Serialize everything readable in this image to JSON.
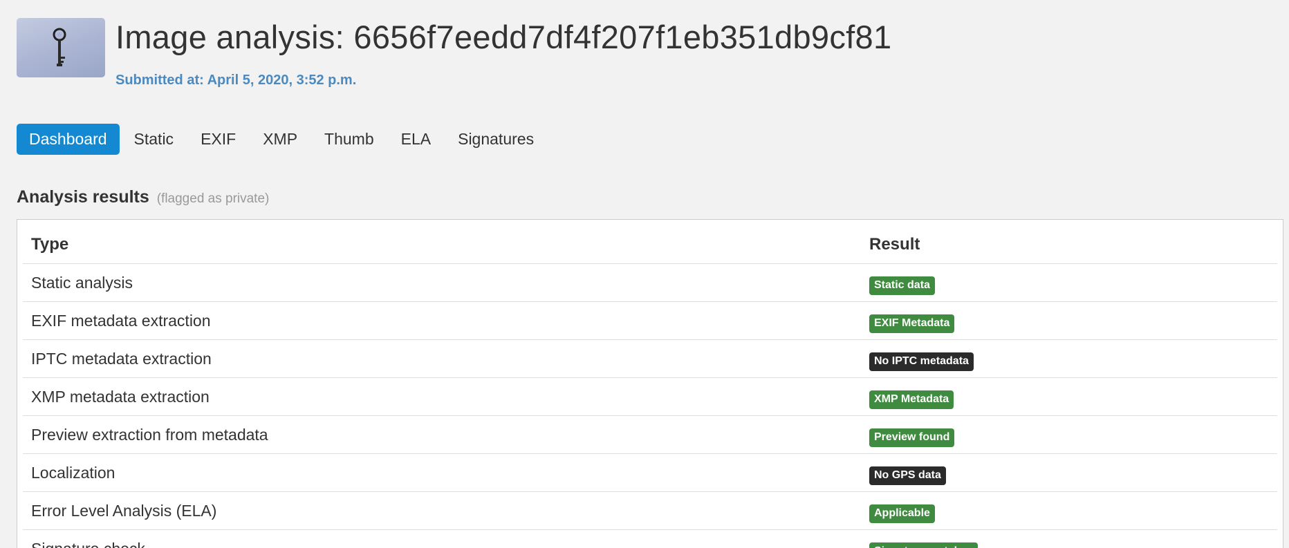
{
  "header": {
    "title": "Image analysis: 6656f7eedd7df4f207f1eb351db9cf81",
    "submitted_label": "Submitted at:",
    "submitted_value": "April 5, 2020, 3:52 p.m.",
    "thumbnail_icon": "key-thumbnail"
  },
  "nav": {
    "tabs": [
      {
        "label": "Dashboard",
        "active": true
      },
      {
        "label": "Static",
        "active": false
      },
      {
        "label": "EXIF",
        "active": false
      },
      {
        "label": "XMP",
        "active": false
      },
      {
        "label": "Thumb",
        "active": false
      },
      {
        "label": "ELA",
        "active": false
      },
      {
        "label": "Signatures",
        "active": false
      }
    ]
  },
  "results": {
    "title": "Analysis results",
    "note": "(flagged as private)",
    "columns": [
      "Type",
      "Result"
    ],
    "rows": [
      {
        "type": "Static analysis",
        "result": "Static data",
        "status": "green"
      },
      {
        "type": "EXIF metadata extraction",
        "result": "EXIF Metadata",
        "status": "green"
      },
      {
        "type": "IPTC metadata extraction",
        "result": "No IPTC metadata",
        "status": "dark"
      },
      {
        "type": "XMP metadata extraction",
        "result": "XMP Metadata",
        "status": "green"
      },
      {
        "type": "Preview extraction from metadata",
        "result": "Preview found",
        "status": "green"
      },
      {
        "type": "Localization",
        "result": "No GPS data",
        "status": "dark"
      },
      {
        "type": "Error Level Analysis (ELA)",
        "result": "Applicable",
        "status": "green"
      },
      {
        "type": "Signature check",
        "result": "Signature matches",
        "status": "green"
      }
    ]
  },
  "colors": {
    "accent": "#1489d1",
    "link": "#4a8abf",
    "success": "#3f8b3f",
    "neutral": "#2b2b2b"
  }
}
